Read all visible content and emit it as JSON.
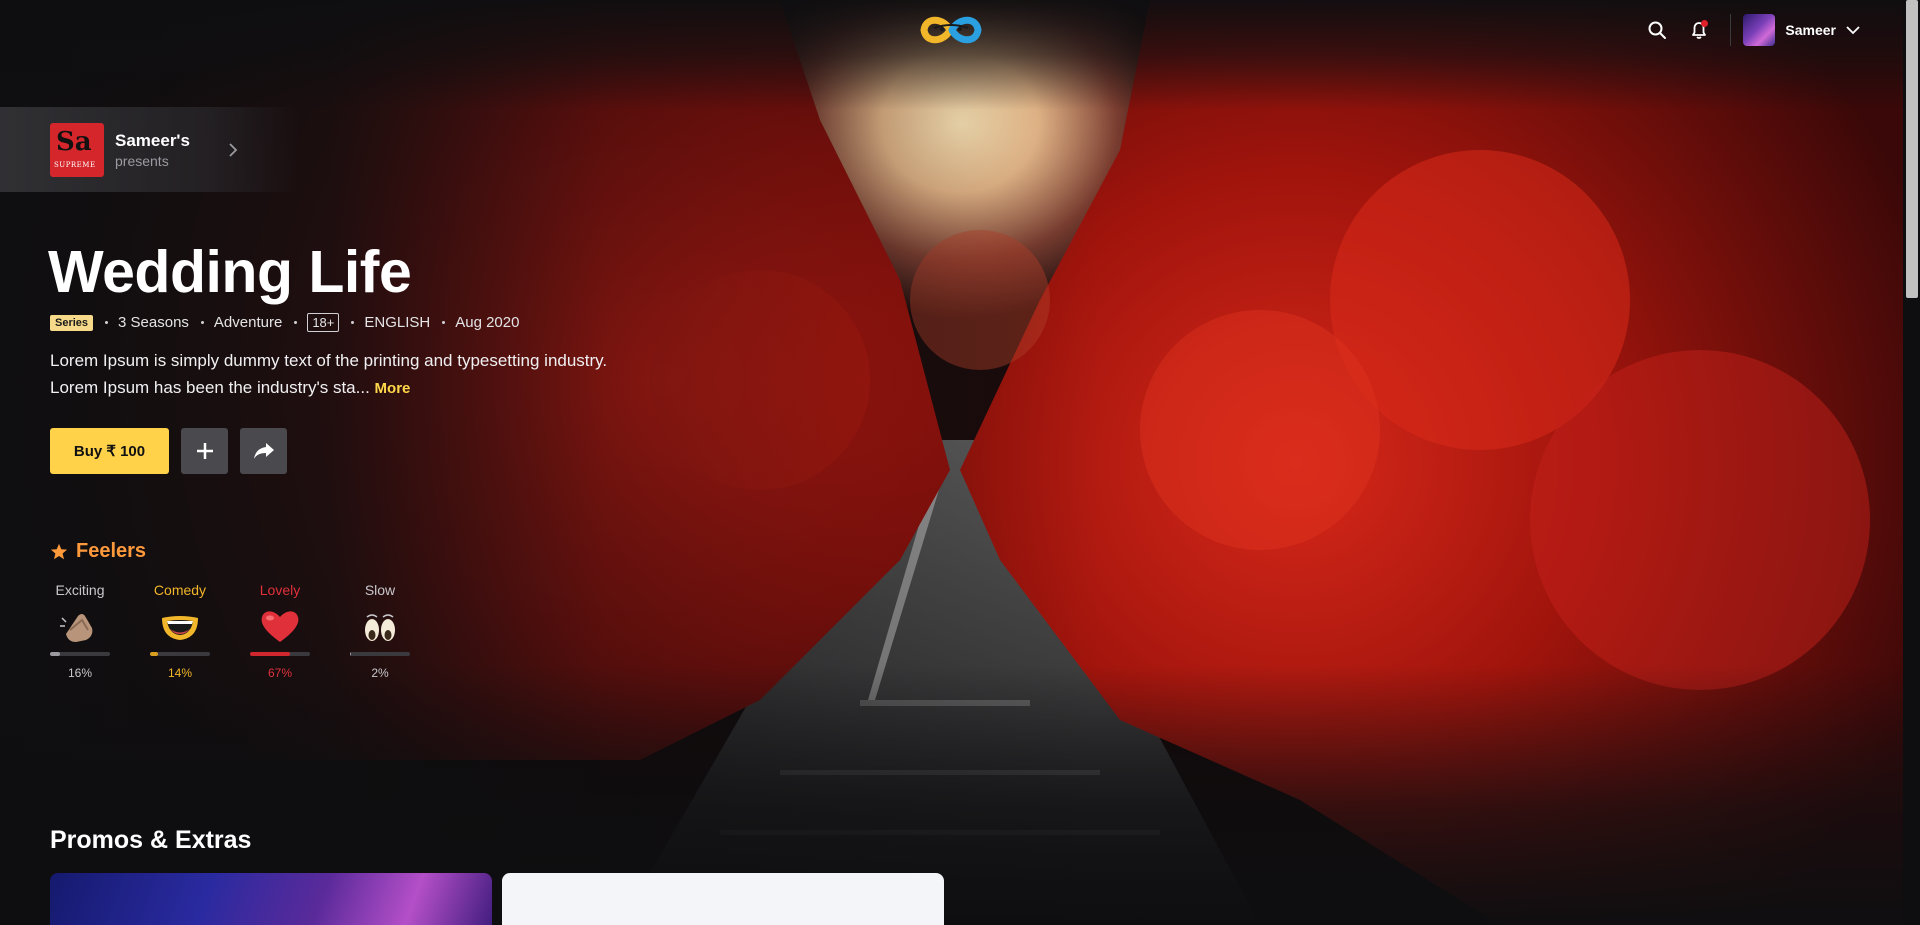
{
  "app": {
    "logo": "infinity-logo"
  },
  "header": {
    "search_icon": "search-icon",
    "bell_icon": "bell-icon",
    "profile_name": "Sameer",
    "dropdown_icon": "chevron-down-icon"
  },
  "presents": {
    "studio_logo_text": "Sa",
    "studio_logo_sub": "SUPREME",
    "name": "Sameer's",
    "sub": "presents"
  },
  "show": {
    "title": "Wedding Life",
    "type_badge": "Series",
    "seasons": "3 Seasons",
    "genre": "Adventure",
    "rating": "18+",
    "language": "ENGLISH",
    "release": "Aug 2020",
    "description": "Lorem Ipsum is simply dummy text of the printing and typesetting industry. Lorem Ipsum has been the industry's sta...",
    "more_label": "More"
  },
  "actions": {
    "buy_label": "Buy ₹ 100",
    "add_icon": "plus-icon",
    "share_icon": "share-icon"
  },
  "feelers": {
    "title": "Feelers",
    "items": [
      {
        "label": "Exciting",
        "percent": "16%",
        "value": 16,
        "color": "#c8c8cc",
        "bar": "#9a9aa0",
        "emoji": "clapping-hands-icon"
      },
      {
        "label": "Comedy",
        "percent": "14%",
        "value": 14,
        "color": "#f2b62a",
        "bar": "#d9a020",
        "emoji": "laughing-face-icon"
      },
      {
        "label": "Lovely",
        "percent": "67%",
        "value": 67,
        "color": "#e0313a",
        "bar": "#d0262e",
        "emoji": "heart-icon"
      },
      {
        "label": "Slow",
        "percent": "2%",
        "value": 2,
        "color": "#c8c8cc",
        "bar": "#9a9aa0",
        "emoji": "eyes-icon"
      }
    ]
  },
  "promos": {
    "title": "Promos & Extras"
  },
  "colors": {
    "accent": "#ffd24a",
    "feelers_title": "#ff9a3c",
    "background": "#0e0e10"
  }
}
